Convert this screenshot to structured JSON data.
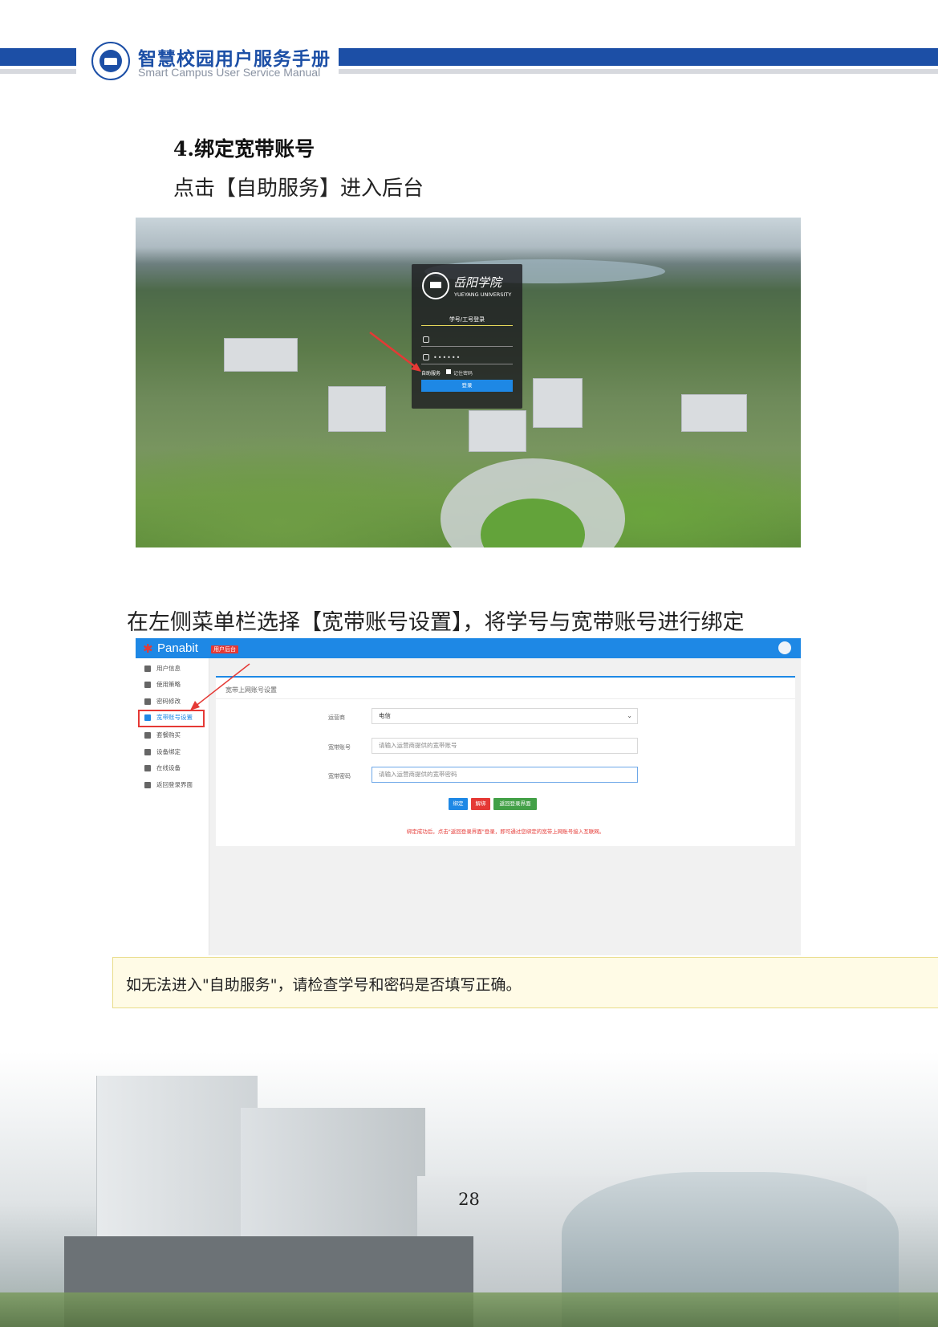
{
  "header": {
    "title": "智慧校园用户服务手册",
    "subtitle": "Smart Campus User Service Manual"
  },
  "section": {
    "title": "4.绑定宽带账号",
    "step1": "点击【自助服务】进入后台",
    "step2": "在左侧菜单栏选择【宽带账号设置】，将学号与宽带账号进行绑定"
  },
  "login_screenshot": {
    "university_cn": "岳阳学院",
    "university_en": "YUEYANG UNIVERSITY",
    "tab_label": "学号/工号登录",
    "password_mask": "••••••",
    "self_service": "自助服务",
    "remember": "记住密码",
    "login_button": "登录"
  },
  "panabit_screenshot": {
    "logo": "Panabit",
    "badge": "用户后台",
    "menu": [
      {
        "label": "用户信息",
        "icon": "user-icon"
      },
      {
        "label": "使用策略",
        "icon": "policy-icon"
      },
      {
        "label": "密码修改",
        "icon": "lock-icon"
      },
      {
        "label": "宽带账号设置",
        "icon": "broadband-icon",
        "active": true
      },
      {
        "label": "套餐购买",
        "icon": "cart-icon"
      },
      {
        "label": "设备绑定",
        "icon": "monitor-icon"
      },
      {
        "label": "在线设备",
        "icon": "device-icon"
      },
      {
        "label": "返回登录界面",
        "icon": "globe-icon"
      }
    ],
    "panel_title": "宽带上网账号设置",
    "form": {
      "operator_label": "运营商",
      "operator_value": "电信",
      "account_label": "宽带账号",
      "account_placeholder": "请输入运营商提供的宽带账号",
      "password_label": "宽带密码",
      "password_placeholder": "请输入运营商提供的宽带密码"
    },
    "buttons": {
      "bind": "绑定",
      "unbind": "解绑",
      "back": "返回登录界面"
    },
    "note": "绑定成功后，点击\"返回登录界面\"登录，即可通过您绑定的宽带上网账号接入互联网。",
    "colors": {
      "primary": "#1e88e5",
      "danger": "#e53935",
      "success": "#43a047"
    }
  },
  "tip": {
    "text": "如无法进入\"自助服务\"，请检查学号和密码是否填写正确。"
  },
  "footer": {
    "page_number": "28"
  }
}
